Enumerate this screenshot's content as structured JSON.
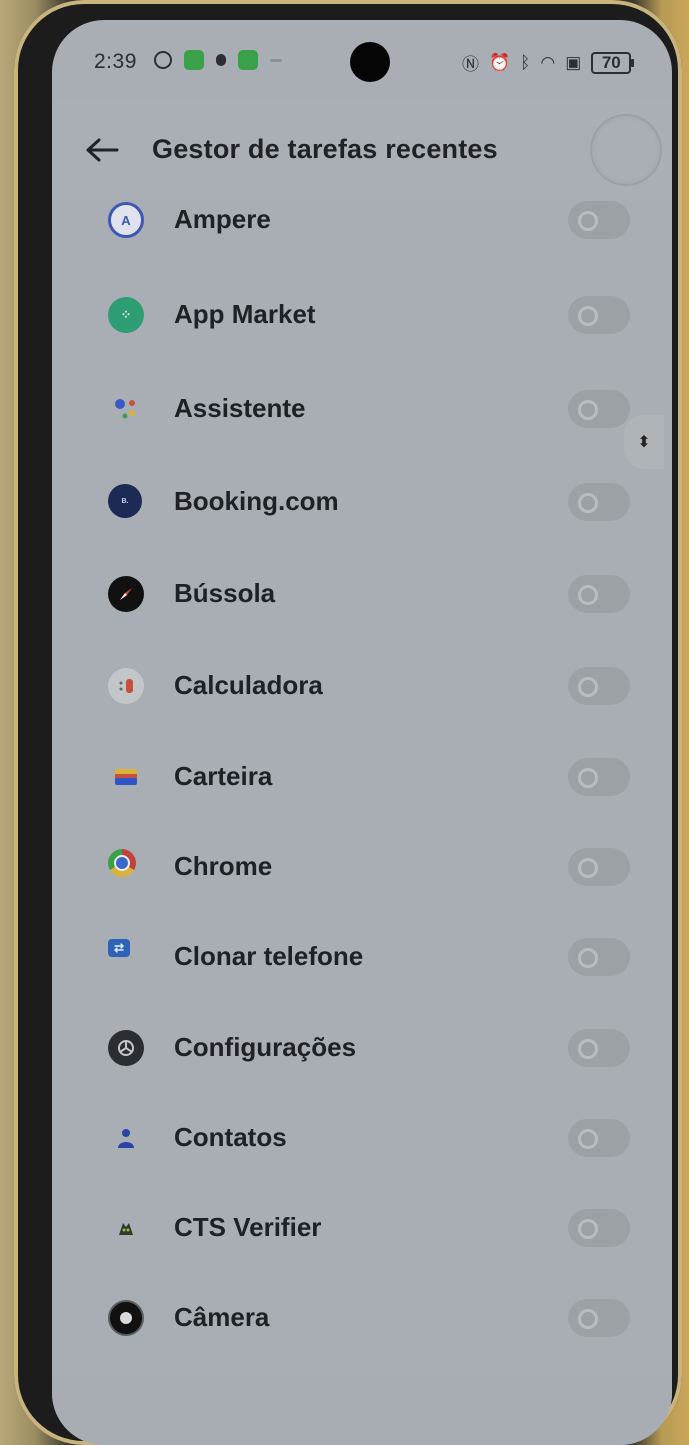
{
  "status_bar": {
    "time": "2:39",
    "battery": "70",
    "icons": [
      "nfc-icon",
      "alarm-icon",
      "bluetooth-icon",
      "wifi-icon",
      "sim-icon"
    ]
  },
  "header": {
    "title": "Gestor de tarefas recentes"
  },
  "apps": [
    {
      "name": "Ampere",
      "icon": "ampere-icon",
      "enabled": false,
      "icon_color": "#2f3f8f"
    },
    {
      "name": "App Market",
      "icon": "app-market-icon",
      "enabled": false,
      "icon_color": "#2e9d73"
    },
    {
      "name": "Assistente",
      "icon": "assistant-icon",
      "enabled": false,
      "icon_color": "#3d57c9"
    },
    {
      "name": "Booking.com",
      "icon": "booking-icon",
      "enabled": false,
      "icon_color": "#1c2a55"
    },
    {
      "name": "Bússola",
      "icon": "compass-icon",
      "enabled": false,
      "icon_color": "#111111"
    },
    {
      "name": "Calculadora",
      "icon": "calculator-icon",
      "enabled": false,
      "icon_color": "#c7503c"
    },
    {
      "name": "Carteira",
      "icon": "wallet-icon",
      "enabled": false,
      "icon_color": "#2f55c8"
    },
    {
      "name": "Chrome",
      "icon": "chrome-icon",
      "enabled": false,
      "icon_color": "#c2413a"
    },
    {
      "name": "Clonar telefone",
      "icon": "clone-phone-icon",
      "enabled": false,
      "icon_color": "#2c63b8"
    },
    {
      "name": "Configurações",
      "icon": "settings-icon",
      "enabled": false,
      "icon_color": "#2a2d31"
    },
    {
      "name": "Contatos",
      "icon": "contacts-icon",
      "enabled": false,
      "icon_color": "#2a45a8"
    },
    {
      "name": "CTS Verifier",
      "icon": "android-icon",
      "enabled": false,
      "icon_color": "#2f3a2a"
    },
    {
      "name": "Câmera",
      "icon": "camera-icon",
      "enabled": false,
      "icon_color": "#111111"
    }
  ]
}
